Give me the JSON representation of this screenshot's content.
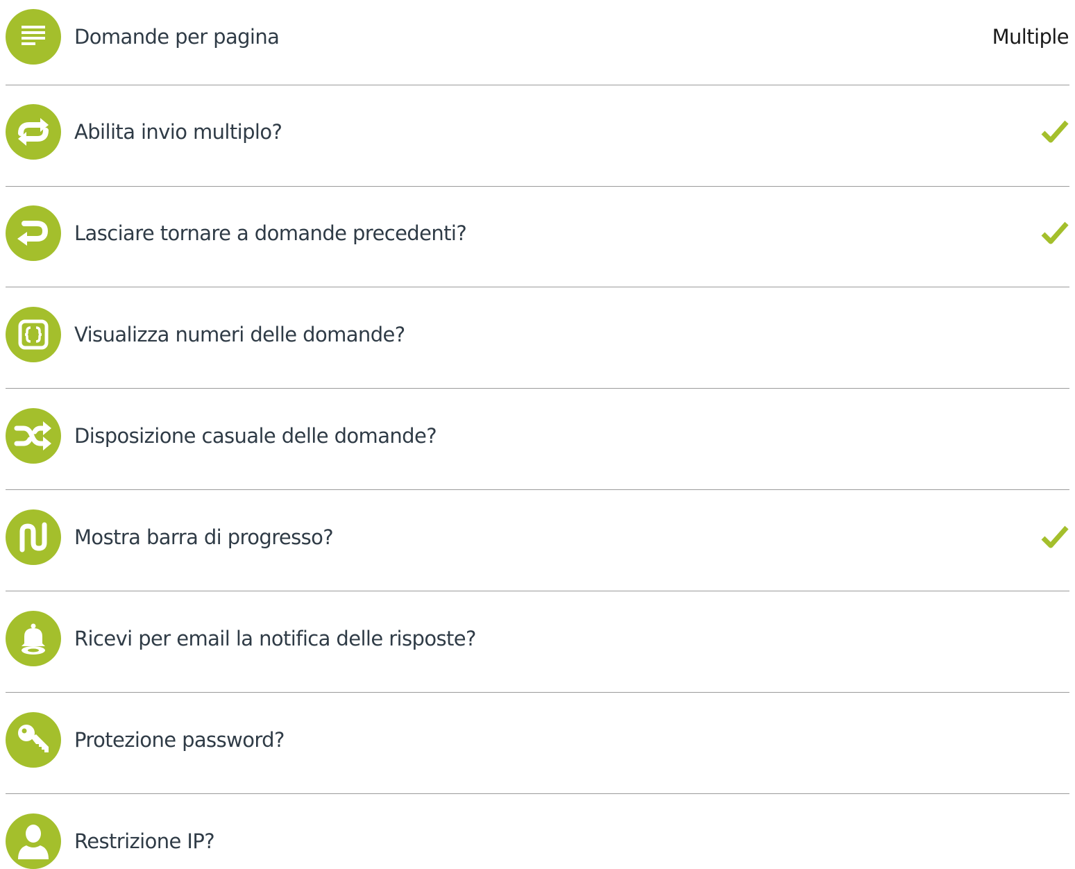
{
  "accent_color": "#a4bf2c",
  "settings": [
    {
      "icon": "align-left-icon",
      "label": "Domande per pagina",
      "value": "Multiple",
      "checked": false
    },
    {
      "icon": "repeat-icon",
      "label": "Abilita invio multiplo?",
      "value": "",
      "checked": true
    },
    {
      "icon": "return-arrow-icon",
      "label": "Lasciare tornare a domande precedenti?",
      "value": "",
      "checked": true
    },
    {
      "icon": "code-braces-icon",
      "label": "Visualizza numeri delle domande?",
      "value": "",
      "checked": false
    },
    {
      "icon": "shuffle-icon",
      "label": "Disposizione casuale delle domande?",
      "value": "",
      "checked": false
    },
    {
      "icon": "path-icon",
      "label": "Mostra barra di progresso?",
      "value": "",
      "checked": true
    },
    {
      "icon": "bell-icon",
      "label": "Ricevi per email la notifica delle risposte?",
      "value": "",
      "checked": false
    },
    {
      "icon": "key-icon",
      "label": "Protezione password?",
      "value": "",
      "checked": false
    },
    {
      "icon": "user-icon",
      "label": "Restrizione IP?",
      "value": "",
      "checked": false
    }
  ]
}
